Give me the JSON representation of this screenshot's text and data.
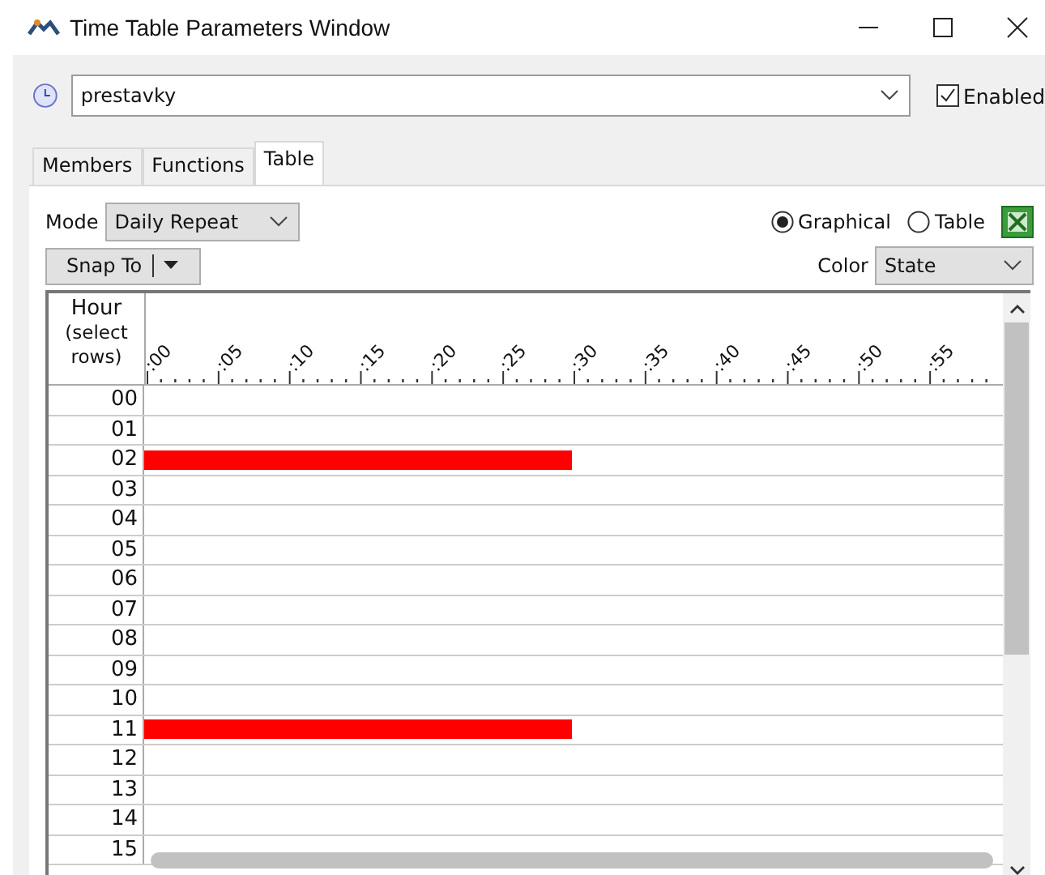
{
  "window": {
    "title": "Time Table Parameters Window"
  },
  "timetable": {
    "name": "prestavky",
    "enabled": true,
    "enabled_label": "Enabled"
  },
  "tabs": [
    {
      "label": "Members",
      "selected": false
    },
    {
      "label": "Functions",
      "selected": false
    },
    {
      "label": "Table",
      "selected": true
    }
  ],
  "mode": {
    "label": "Mode",
    "value": "Daily Repeat"
  },
  "view": [
    {
      "label": "Graphical",
      "selected": true
    },
    {
      "label": "Table",
      "selected": false
    }
  ],
  "snap_button": "Snap To",
  "color": {
    "label": "Color",
    "value": "State"
  },
  "grid": {
    "hour_header": "Hour",
    "hour_hint": "(select rows)",
    "ticks": [
      ":00",
      ":05",
      ":10",
      ":15",
      ":20",
      ":25",
      ":30",
      ":35",
      ":40",
      ":45",
      ":50",
      ":55"
    ],
    "rows": [
      {
        "hour": "00"
      },
      {
        "hour": "01"
      },
      {
        "hour": "02",
        "scheduled": true
      },
      {
        "hour": "03"
      },
      {
        "hour": "04"
      },
      {
        "hour": "05"
      },
      {
        "hour": "06"
      },
      {
        "hour": "07"
      },
      {
        "hour": "08"
      },
      {
        "hour": "09"
      },
      {
        "hour": "10"
      },
      {
        "hour": "11",
        "scheduled": true
      },
      {
        "hour": "12"
      },
      {
        "hour": "13"
      },
      {
        "hour": "14"
      },
      {
        "hour": "15"
      }
    ]
  }
}
